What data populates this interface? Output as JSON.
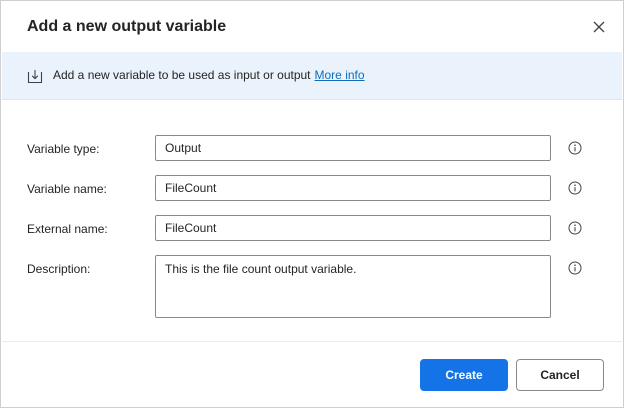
{
  "dialog": {
    "title": "Add a new output variable",
    "close_icon": "close-icon"
  },
  "info_bar": {
    "icon": "download-arrow-icon",
    "text": "Add a new variable to be used as input or output",
    "link": "More info"
  },
  "form": {
    "variable_type": {
      "label": "Variable type:",
      "value": "Output"
    },
    "variable_name": {
      "label": "Variable name:",
      "value": "FileCount"
    },
    "external_name": {
      "label": "External name:",
      "value": "FileCount"
    },
    "description": {
      "label": "Description:",
      "value": "This is the file count output variable."
    }
  },
  "footer": {
    "create_label": "Create",
    "cancel_label": "Cancel"
  },
  "colors": {
    "primary": "#1473e6",
    "info_bar_bg": "#eaf2fc",
    "link": "#0f6cbd"
  }
}
